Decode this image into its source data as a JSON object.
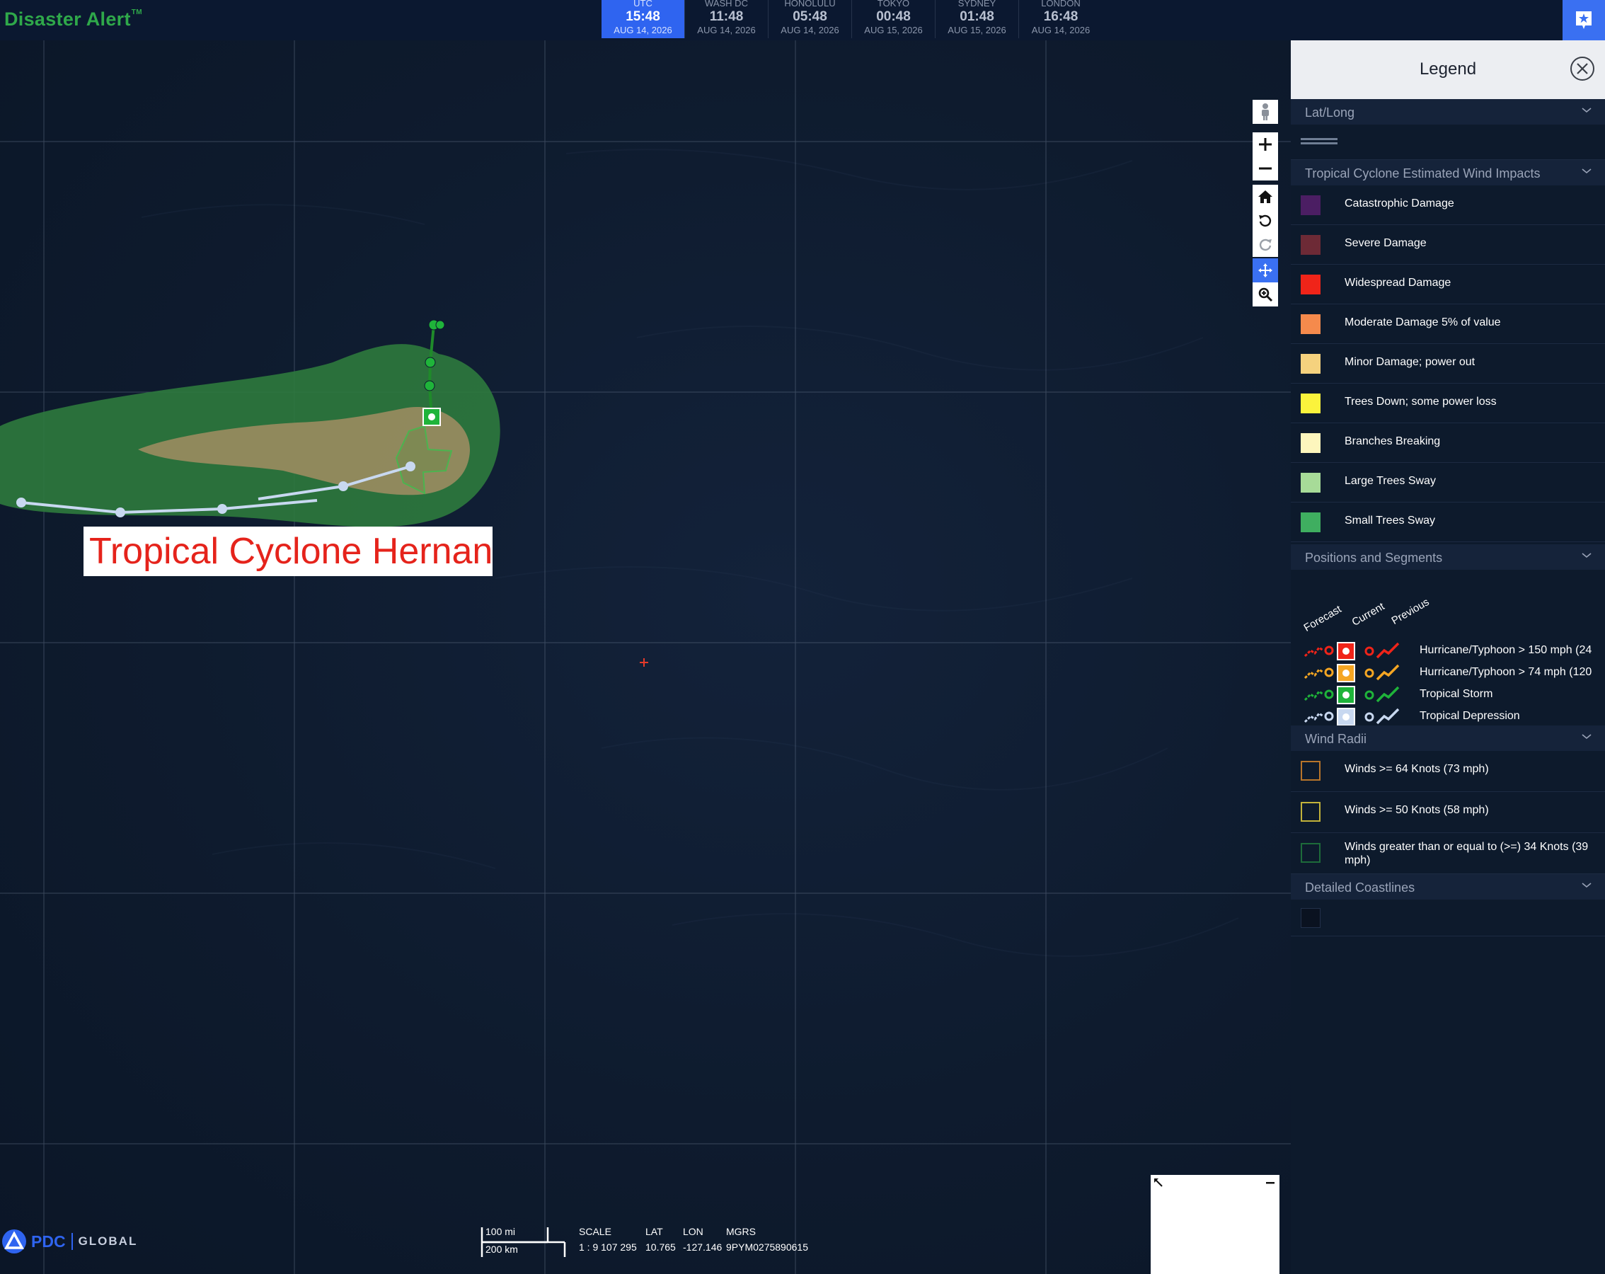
{
  "header": {
    "brand": "Disaster Alert",
    "brand_tm": "TM",
    "clocks": [
      {
        "zone": "UTC",
        "time": "15:48",
        "date": "AUG 14, 2026",
        "active": true
      },
      {
        "zone": "WASH DC",
        "time": "11:48",
        "date": "AUG 14, 2026"
      },
      {
        "zone": "HONOLULU",
        "time": "05:48",
        "date": "AUG 14, 2026"
      },
      {
        "zone": "TOKYO",
        "time": "00:48",
        "date": "AUG 15, 2026"
      },
      {
        "zone": "SYDNEY",
        "time": "01:48",
        "date": "AUG 15, 2026"
      },
      {
        "zone": "LONDON",
        "time": "16:48",
        "date": "AUG 14, 2026"
      }
    ],
    "alert_icon": "alert-star-icon"
  },
  "map": {
    "storm_label": "Tropical Cyclone Hernan",
    "controls": [
      "street-view-icon",
      "zoom-in-icon",
      "zoom-out-icon",
      "home-icon",
      "rotate-left-icon",
      "rotate-right-icon",
      "pan-icon",
      "zoom-box-icon"
    ],
    "footer": {
      "logo": "PDC",
      "logo_sub": "GLOBAL",
      "scale_mi": "100 mi",
      "scale_km": "200 km",
      "scale_header": "SCALE",
      "scale_value": "1 : 9 107 295",
      "lat_header": "LAT",
      "lat_value": "10.765",
      "lon_header": "LON",
      "lon_value": "-127.146",
      "mgrs_header": "MGRS",
      "mgrs_value": "9PYM0275890615"
    },
    "colors": {
      "wind_outer": "#2e7a3d",
      "wind_inner": "#a28d63",
      "track_past": "#c8d8f0",
      "track_forecast": "#1f8a2a",
      "crosshair": "#e53a2a"
    }
  },
  "legend": {
    "title": "Legend",
    "sections": {
      "latlong": "Lat/Long",
      "wind_impacts": "Tropical Cyclone Estimated Wind Impacts",
      "positions": "Positions and Segments",
      "wind_radii": "Wind Radii",
      "coastlines": "Detailed Coastlines"
    },
    "impacts": [
      {
        "label": "Catastrophic Damage",
        "color": "#4b1e63"
      },
      {
        "label": "Severe Damage",
        "color": "#6d2a36"
      },
      {
        "label": "Widespread Damage",
        "color": "#f02419"
      },
      {
        "label": "Moderate Damage 5% of value",
        "color": "#f58a4c"
      },
      {
        "label": "Minor Damage; power out",
        "color": "#f5d27e"
      },
      {
        "label": "Trees Down; some power loss",
        "color": "#fbf33c"
      },
      {
        "label": "Branches Breaking",
        "color": "#fdf6bd"
      },
      {
        "label": "Large Trees Sway",
        "color": "#a7db98"
      },
      {
        "label": "Small Trees Sway",
        "color": "#3fae60"
      }
    ],
    "positions": {
      "headers": [
        "Forecast",
        "Current",
        "Previous"
      ],
      "rows": [
        {
          "label": "Hurricane/Typhoon > 150 mph (24",
          "color": "#f02419"
        },
        {
          "label": "Hurricane/Typhoon > 74 mph (120",
          "color": "#f5a623"
        },
        {
          "label": "Tropical Storm",
          "color": "#1fb43a"
        },
        {
          "label": "Tropical Depression",
          "color": "#c8d8f0"
        }
      ]
    },
    "wind_radii": [
      {
        "label": "Winds >= 64 Knots (73 mph)",
        "color": "#b7742a"
      },
      {
        "label": "Winds >= 50 Knots (58 mph)",
        "color": "#c2b23a"
      },
      {
        "label": "Winds greater than or equal to (>=) 34 Knots (39 mph)",
        "color": "#1d6b3a"
      }
    ]
  }
}
